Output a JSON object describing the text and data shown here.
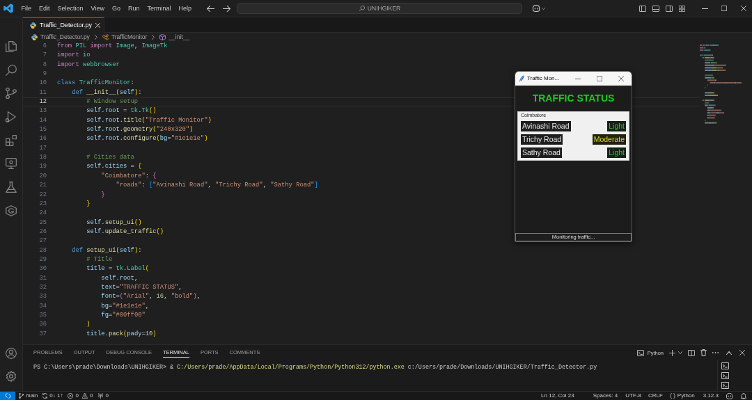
{
  "title_bar": {
    "menu": [
      "File",
      "Edit",
      "Selection",
      "View",
      "Go",
      "Run",
      "Terminal",
      "Help"
    ],
    "command_center": {
      "label": "UNIHGIKER"
    }
  },
  "editor": {
    "tabs": [
      {
        "label": "Traffic_Detector.py",
        "selected": true
      }
    ],
    "breadcrumb": [
      {
        "label": "Traffic_Detector.py",
        "kind": "file"
      },
      {
        "label": "TrafficMonitor",
        "kind": "class"
      },
      {
        "label": "__init__",
        "kind": "method"
      }
    ],
    "lines": [
      {
        "number": "6",
        "current": false,
        "tokens": [
          {
            "text": "from",
            "kind": "keyword"
          },
          {
            "text": " PIL",
            "kind": "type"
          },
          {
            "text": " import",
            "kind": "keyword"
          },
          {
            "text": " Image",
            "kind": "type"
          },
          {
            "text": ", ",
            "kind": "plain"
          },
          {
            "text": "ImageTk",
            "kind": "type"
          }
        ]
      },
      {
        "number": "7",
        "current": false,
        "tokens": [
          {
            "text": "import",
            "kind": "keyword"
          },
          {
            "text": " io",
            "kind": "type"
          }
        ]
      },
      {
        "number": "8",
        "current": false,
        "tokens": [
          {
            "text": "import",
            "kind": "keyword"
          },
          {
            "text": " webbrowser",
            "kind": "type"
          }
        ]
      },
      {
        "number": "9",
        "current": false
      },
      {
        "number": "10",
        "current": false,
        "tokens": [
          {
            "text": "class",
            "kind": "storage"
          },
          {
            "text": " TrafficMonitor",
            "kind": "type"
          },
          {
            "text": ":",
            "kind": "plain"
          }
        ]
      },
      {
        "number": "11",
        "current": false,
        "tokens": [
          {
            "text": "    def",
            "kind": "storage"
          },
          {
            "text": " __init__",
            "kind": "function"
          },
          {
            "text": "(",
            "kind": "bracket"
          },
          {
            "text": "self",
            "kind": "variable"
          },
          {
            "text": ")",
            "kind": "bracket"
          },
          {
            "text": ":",
            "kind": "plain"
          }
        ]
      },
      {
        "number": "12",
        "current": true,
        "tokens": [
          {
            "text": "        # Window setup",
            "kind": "comment"
          }
        ]
      },
      {
        "number": "13",
        "current": false,
        "tokens": [
          {
            "text": "        self.root",
            "kind": "variable"
          },
          {
            "text": " = ",
            "kind": "plain"
          },
          {
            "text": "tk",
            "kind": "type"
          },
          {
            "text": ".",
            "kind": "plain"
          },
          {
            "text": "Tk",
            "kind": "type"
          },
          {
            "text": "()",
            "kind": "bracket"
          }
        ]
      },
      {
        "number": "14",
        "current": false,
        "tokens": [
          {
            "text": "        self.root.",
            "kind": "variable"
          },
          {
            "text": "title",
            "kind": "function"
          },
          {
            "text": "(",
            "kind": "bracket"
          },
          {
            "text": "\"Traffic Monitor\"",
            "kind": "string"
          },
          {
            "text": ")",
            "kind": "bracket"
          }
        ]
      },
      {
        "number": "15",
        "current": false,
        "tokens": [
          {
            "text": "        self.root.",
            "kind": "variable"
          },
          {
            "text": "geometry",
            "kind": "function"
          },
          {
            "text": "(",
            "kind": "bracket"
          },
          {
            "text": "\"240x320\"",
            "kind": "string"
          },
          {
            "text": ")",
            "kind": "bracket"
          }
        ]
      },
      {
        "number": "16",
        "current": false,
        "tokens": [
          {
            "text": "        self.root.",
            "kind": "variable"
          },
          {
            "text": "configure",
            "kind": "function"
          },
          {
            "text": "(",
            "kind": "bracket"
          },
          {
            "text": "bg",
            "kind": "variable"
          },
          {
            "text": "=",
            "kind": "plain"
          },
          {
            "text": "\"#1e1e1e\"",
            "kind": "string"
          },
          {
            "text": ")",
            "kind": "bracket"
          }
        ]
      },
      {
        "number": "17",
        "current": false
      },
      {
        "number": "18",
        "current": false,
        "tokens": [
          {
            "text": "        # Cities data",
            "kind": "comment"
          }
        ]
      },
      {
        "number": "19",
        "current": false,
        "tokens": [
          {
            "text": "        self.cities",
            "kind": "variable"
          },
          {
            "text": " = ",
            "kind": "plain"
          },
          {
            "text": "{",
            "kind": "bracket"
          }
        ]
      },
      {
        "number": "20",
        "current": false,
        "tokens": [
          {
            "text": "            \"Coimbatore\"",
            "kind": "string"
          },
          {
            "text": ": ",
            "kind": "plain"
          },
          {
            "text": "{",
            "kind": "bracket2"
          }
        ]
      },
      {
        "number": "21",
        "current": false,
        "tokens": [
          {
            "text": "                \"roads\"",
            "kind": "string"
          },
          {
            "text": ": ",
            "kind": "plain"
          },
          {
            "text": "[",
            "kind": "bracket3"
          },
          {
            "text": "\"Avinashi Road\"",
            "kind": "string"
          },
          {
            "text": ", ",
            "kind": "plain"
          },
          {
            "text": "\"Trichy Road\"",
            "kind": "string"
          },
          {
            "text": ", ",
            "kind": "plain"
          },
          {
            "text": "\"Sathy Road\"",
            "kind": "string"
          },
          {
            "text": "]",
            "kind": "bracket3"
          }
        ]
      },
      {
        "number": "22",
        "current": false,
        "tokens": [
          {
            "text": "            }",
            "kind": "bracket2"
          }
        ]
      },
      {
        "number": "23",
        "current": false,
        "tokens": [
          {
            "text": "        }",
            "kind": "bracket"
          }
        ]
      },
      {
        "number": "24",
        "current": false
      },
      {
        "number": "25",
        "current": false,
        "tokens": [
          {
            "text": "        self.",
            "kind": "variable"
          },
          {
            "text": "setup_ui",
            "kind": "function"
          },
          {
            "text": "()",
            "kind": "bracket"
          }
        ]
      },
      {
        "number": "26",
        "current": false,
        "tokens": [
          {
            "text": "        self.",
            "kind": "variable"
          },
          {
            "text": "update_traffic",
            "kind": "function"
          },
          {
            "text": "()",
            "kind": "bracket"
          }
        ]
      },
      {
        "number": "27",
        "current": false
      },
      {
        "number": "28",
        "current": false,
        "tokens": [
          {
            "text": "    def",
            "kind": "storage"
          },
          {
            "text": " setup_ui",
            "kind": "function"
          },
          {
            "text": "(",
            "kind": "bracket"
          },
          {
            "text": "self",
            "kind": "variable"
          },
          {
            "text": ")",
            "kind": "bracket"
          },
          {
            "text": ":",
            "kind": "plain"
          }
        ]
      },
      {
        "number": "29",
        "current": false,
        "tokens": [
          {
            "text": "        # Title",
            "kind": "comment"
          }
        ]
      },
      {
        "number": "30",
        "current": false,
        "tokens": [
          {
            "text": "        title",
            "kind": "variable"
          },
          {
            "text": " = ",
            "kind": "plain"
          },
          {
            "text": "tk",
            "kind": "type"
          },
          {
            "text": ".",
            "kind": "plain"
          },
          {
            "text": "Label",
            "kind": "type"
          },
          {
            "text": "(",
            "kind": "bracket"
          }
        ]
      },
      {
        "number": "31",
        "current": false,
        "tokens": [
          {
            "text": "            self.root",
            "kind": "variable"
          },
          {
            "text": ",",
            "kind": "plain"
          }
        ]
      },
      {
        "number": "32",
        "current": false,
        "tokens": [
          {
            "text": "            text",
            "kind": "variable"
          },
          {
            "text": "=",
            "kind": "plain"
          },
          {
            "text": "\"TRAFFIC STATUS\"",
            "kind": "string"
          },
          {
            "text": ",",
            "kind": "plain"
          }
        ]
      },
      {
        "number": "33",
        "current": false,
        "tokens": [
          {
            "text": "            font",
            "kind": "variable"
          },
          {
            "text": "=",
            "kind": "plain"
          },
          {
            "text": "(",
            "kind": "bracket2"
          },
          {
            "text": "\"Arial\"",
            "kind": "string"
          },
          {
            "text": ", ",
            "kind": "plain"
          },
          {
            "text": "16",
            "kind": "number"
          },
          {
            "text": ", ",
            "kind": "plain"
          },
          {
            "text": "\"bold\"",
            "kind": "string"
          },
          {
            "text": ")",
            "kind": "bracket2"
          },
          {
            "text": ",",
            "kind": "plain"
          }
        ]
      },
      {
        "number": "34",
        "current": false,
        "tokens": [
          {
            "text": "            bg",
            "kind": "variable"
          },
          {
            "text": "=",
            "kind": "plain"
          },
          {
            "text": "\"#1e1e1e\"",
            "kind": "string"
          },
          {
            "text": ",",
            "kind": "plain"
          }
        ]
      },
      {
        "number": "35",
        "current": false,
        "tokens": [
          {
            "text": "            fg",
            "kind": "variable"
          },
          {
            "text": "=",
            "kind": "plain"
          },
          {
            "text": "\"#00ff00\"",
            "kind": "string"
          }
        ]
      },
      {
        "number": "36",
        "current": false,
        "tokens": [
          {
            "text": "        )",
            "kind": "bracket"
          }
        ]
      },
      {
        "number": "37",
        "current": false,
        "tokens": [
          {
            "text": "        title.",
            "kind": "variable"
          },
          {
            "text": "pack",
            "kind": "function"
          },
          {
            "text": "(",
            "kind": "bracket"
          },
          {
            "text": "pady",
            "kind": "variable"
          },
          {
            "text": "=",
            "kind": "plain"
          },
          {
            "text": "10",
            "kind": "number"
          },
          {
            "text": ")",
            "kind": "bracket"
          }
        ]
      }
    ]
  },
  "app_window": {
    "title": "Traffic Mon...",
    "heading": "TRAFFIC STATUS",
    "city": {
      "name": "Coimbatore",
      "roads": [
        {
          "name": "Avinashi Road",
          "status": "Light",
          "kind": "light"
        },
        {
          "name": "Trichy Road",
          "status": "Moderate",
          "kind": "moderate"
        },
        {
          "name": "Sathy Road",
          "status": "Light",
          "kind": "light"
        }
      ]
    },
    "status": "Monitoring traffic..."
  },
  "panel": {
    "tabs": [
      {
        "label": "PROBLEMS",
        "selected": false
      },
      {
        "label": "OUTPUT",
        "selected": false
      },
      {
        "label": "DEBUG CONSOLE",
        "selected": false
      },
      {
        "label": "TERMINAL",
        "selected": true
      },
      {
        "label": "PORTS",
        "selected": false
      },
      {
        "label": "COMMENTS",
        "selected": false
      }
    ],
    "terminal": {
      "profile": "Python",
      "lines": [
        {
          "segments": [
            {
              "text": "PS C:\\Users\\prade\\Downloads\\UNIHGIKER> & ",
              "kind": "text"
            },
            {
              "text": "C:/Users/prade/AppData/Local/Programs/Python/Python312/python.exe",
              "kind": "executable"
            },
            {
              "text": " c:/Users/prade/Downloads/UNIHGIKER/Traffic_Detector.py",
              "kind": "text"
            }
          ]
        }
      ]
    }
  },
  "status_bar": {
    "branch": "main",
    "sync": "0↓ 1↑",
    "errors": "0",
    "warnings": "0",
    "ports": "0",
    "cursor": "Ln 12, Col 23",
    "indentation": "Spaces: 4",
    "encoding": "UTF-8",
    "line_ending": "CRLF",
    "language": "Python",
    "interpreter": "3.12.3"
  }
}
